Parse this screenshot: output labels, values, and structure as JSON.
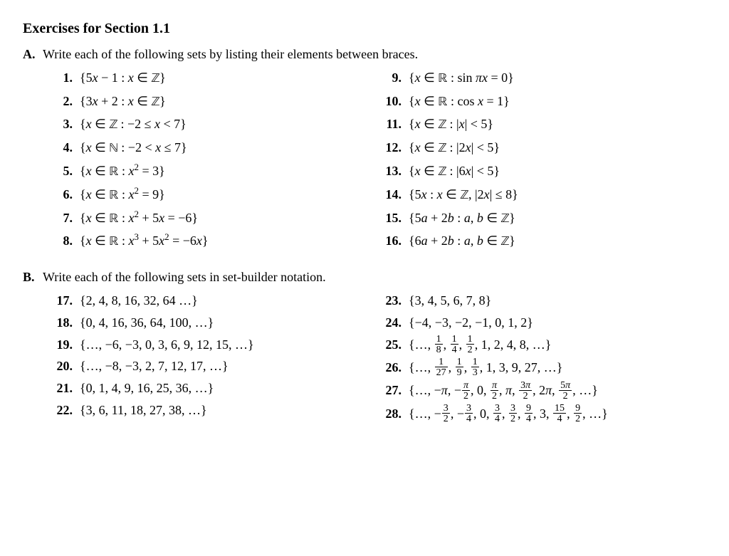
{
  "title": "Exercises for Section 1.1",
  "sections": {
    "A": {
      "letter": "A.",
      "prompt": "Write each of the following sets by listing their elements between braces.",
      "left": [
        {
          "n": "1.",
          "expr": "{5<i>x</i> − 1 : <i>x</i> ∈ <span class='bb'>ℤ</span>}"
        },
        {
          "n": "2.",
          "expr": "{3<i>x</i> + 2 : <i>x</i> ∈ <span class='bb'>ℤ</span>}"
        },
        {
          "n": "3.",
          "expr": "{<i>x</i> ∈ <span class='bb'>ℤ</span> : −2 ≤ <i>x</i> &lt; 7}"
        },
        {
          "n": "4.",
          "expr": "{<i>x</i> ∈ <span class='bb'>ℕ</span> : −2 &lt; <i>x</i> ≤ 7}"
        },
        {
          "n": "5.",
          "expr": "{<i>x</i> ∈ <span class='bb'>ℝ</span> : <i>x</i><sup>2</sup> = 3}"
        },
        {
          "n": "6.",
          "expr": "{<i>x</i> ∈ <span class='bb'>ℝ</span> : <i>x</i><sup>2</sup> = 9}"
        },
        {
          "n": "7.",
          "expr": "{<i>x</i> ∈ <span class='bb'>ℝ</span> : <i>x</i><sup>2</sup> + 5<i>x</i> = −6}"
        },
        {
          "n": "8.",
          "expr": "{<i>x</i> ∈ <span class='bb'>ℝ</span> : <i>x</i><sup>3</sup> + 5<i>x</i><sup>2</sup> = −6<i>x</i>}"
        }
      ],
      "right": [
        {
          "n": "9.",
          "expr": "{<i>x</i> ∈ <span class='bb'>ℝ</span> : sin <i>πx</i> = 0}"
        },
        {
          "n": "10.",
          "expr": "{<i>x</i> ∈ <span class='bb'>ℝ</span> : cos <i>x</i> = 1}"
        },
        {
          "n": "11.",
          "expr": "{<i>x</i> ∈ <span class='bb'>ℤ</span> : |<i>x</i>| &lt; 5}"
        },
        {
          "n": "12.",
          "expr": "{<i>x</i> ∈ <span class='bb'>ℤ</span> : |2<i>x</i>| &lt; 5}"
        },
        {
          "n": "13.",
          "expr": "{<i>x</i> ∈ <span class='bb'>ℤ</span> : |6<i>x</i>| &lt; 5}"
        },
        {
          "n": "14.",
          "expr": "{5<i>x</i> : <i>x</i> ∈ <span class='bb'>ℤ</span>, |2<i>x</i>| ≤ 8}"
        },
        {
          "n": "15.",
          "expr": "{5<i>a</i> + 2<i>b</i> : <i>a</i>, <i>b</i> ∈ <span class='bb'>ℤ</span>}"
        },
        {
          "n": "16.",
          "expr": "{6<i>a</i> + 2<i>b</i> : <i>a</i>, <i>b</i> ∈ <span class='bb'>ℤ</span>}"
        }
      ]
    },
    "B": {
      "letter": "B.",
      "prompt": "Write each of the following sets in set-builder notation.",
      "left": [
        {
          "n": "17.",
          "expr": "{2, 4, 8, 16, 32, 64 …}"
        },
        {
          "n": "18.",
          "expr": "{0, 4, 16, 36, 64, 100, …}"
        },
        {
          "n": "19.",
          "expr": "{…, −6, −3, 0, 3, 6, 9, 12, 15, …}"
        },
        {
          "n": "20.",
          "expr": "{…, −8, −3, 2, 7, 12, 17, …}"
        },
        {
          "n": "21.",
          "expr": "{0, 1, 4, 9, 16, 25, 36, …}"
        },
        {
          "n": "22.",
          "expr": "{3, 6, 11, 18, 27, 38, …}"
        }
      ],
      "right": [
        {
          "n": "23.",
          "expr": "{3, 4, 5, 6, 7, 8}"
        },
        {
          "n": "24.",
          "expr": "{−4, −3, −2, −1, 0, 1, 2}"
        },
        {
          "n": "25.",
          "expr": "{…, <span class='frac'><span class='n'>1</span><span class='d'>8</span></span>, <span class='frac'><span class='n'>1</span><span class='d'>4</span></span>, <span class='frac'><span class='n'>1</span><span class='d'>2</span></span>, 1, 2, 4, 8, …}"
        },
        {
          "n": "26.",
          "expr": "{…, <span class='frac'><span class='n'>1</span><span class='d'>27</span></span>, <span class='frac'><span class='n'>1</span><span class='d'>9</span></span>, <span class='frac'><span class='n'>1</span><span class='d'>3</span></span>, 1, 3, 9, 27, …}"
        },
        {
          "n": "27.",
          "expr": "{…, −<i>π</i>, −<span class='frac'><span class='n'><i>π</i></span><span class='d'>2</span></span>, 0, <span class='frac'><span class='n'><i>π</i></span><span class='d'>2</span></span>, <i>π</i>, <span class='frac'><span class='n'>3<i>π</i></span><span class='d'>2</span></span>, 2<i>π</i>, <span class='frac'><span class='n'>5<i>π</i></span><span class='d'>2</span></span>, …}"
        },
        {
          "n": "28.",
          "expr": "{…, −<span class='frac'><span class='n'>3</span><span class='d'>2</span></span>, −<span class='frac'><span class='n'>3</span><span class='d'>4</span></span>, 0, <span class='frac'><span class='n'>3</span><span class='d'>4</span></span>, <span class='frac'><span class='n'>3</span><span class='d'>2</span></span>, <span class='frac'><span class='n'>9</span><span class='d'>4</span></span>, 3, <span class='frac'><span class='n'>15</span><span class='d'>4</span></span>, <span class='frac'><span class='n'>9</span><span class='d'>2</span></span>, …}"
        }
      ]
    }
  }
}
